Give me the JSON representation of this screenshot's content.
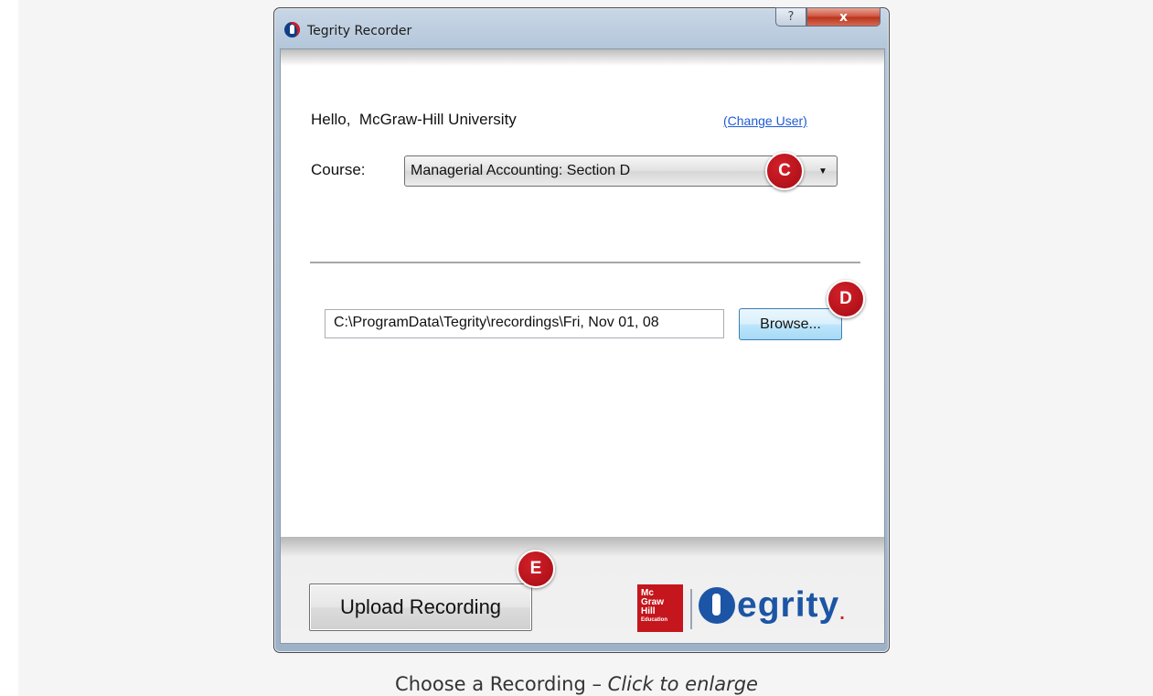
{
  "window": {
    "title": "Tegrity Recorder",
    "help_label": "?",
    "close_label": "x"
  },
  "user": {
    "hello_label": "Hello,  McGraw-Hill University",
    "change_user_link": "(Change User)"
  },
  "course": {
    "label": "Course:",
    "selected": "Managerial Accounting: Section D"
  },
  "recording": {
    "path_value": "C:\\ProgramData\\Tegrity\\recordings\\Fri, Nov 01, 08",
    "browse_label": "Browse..."
  },
  "upload": {
    "button_label": "Upload Recording"
  },
  "logos": {
    "mcgraw_hill_lines": [
      "Mc",
      "Graw",
      "Hill",
      "Education"
    ],
    "tegrity_text": "egrity",
    "tegrity_dot": "."
  },
  "markers": {
    "c": "C",
    "d": "D",
    "e": "E"
  },
  "caption": {
    "text": "Choose a Recording – ",
    "emphasis": "Click to enlarge"
  },
  "colors": {
    "marker": "#b5121b",
    "link": "#1f5bd6",
    "tegrity_blue": "#1c55a5",
    "mcgraw_red": "#c4161c"
  }
}
